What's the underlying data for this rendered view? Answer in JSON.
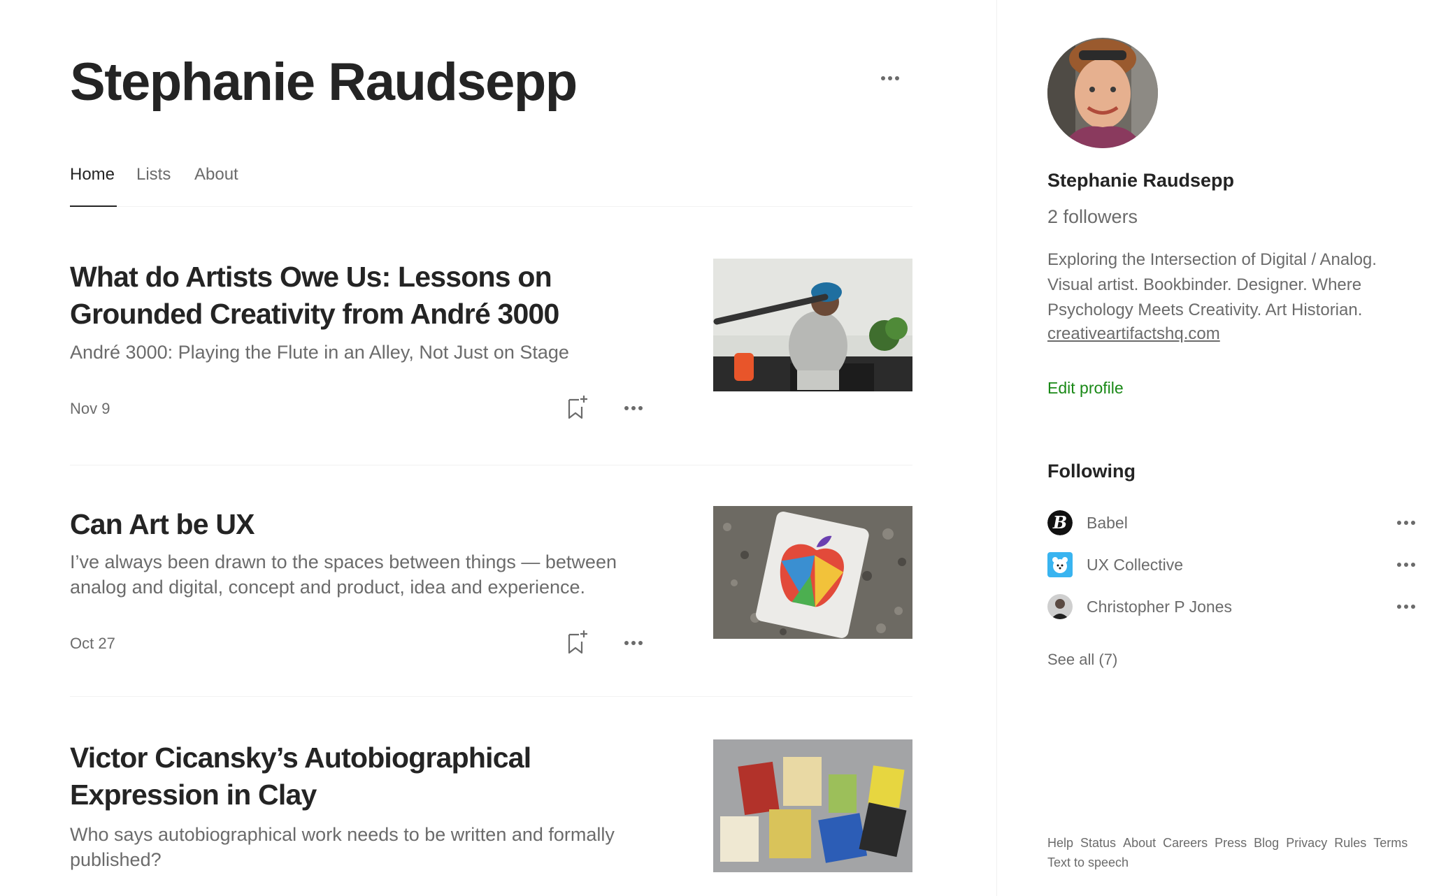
{
  "profile": {
    "name": "Stephanie Raudsepp"
  },
  "tabs": [
    {
      "label": "Home",
      "active": true
    },
    {
      "label": "Lists",
      "active": false
    },
    {
      "label": "About",
      "active": false
    }
  ],
  "articles": [
    {
      "title": "What do Artists Owe Us: Lessons on Grounded Creativity from André 3000",
      "subtitle": "André 3000: Playing the Flute in an Alley, Not Just on Stage",
      "date": "Nov 9",
      "thumbnail_icon": "musician-flute-photo"
    },
    {
      "title": "Can Art be UX",
      "subtitle": "I’ve always been drawn to the spaces between things — between analog and digital, concept and product, idea and experience.",
      "date": "Oct 27",
      "thumbnail_icon": "apple-logo-card-photo"
    },
    {
      "title": "Victor Cicansky’s Autobiographical Expression in Clay",
      "subtitle": "Who says autobiographical work needs to be written and formally published?",
      "thumbnail_icon": "clay-books-photo"
    }
  ],
  "sidebar": {
    "name": "Stephanie Raudsepp",
    "followers": "2 followers",
    "bio": "Exploring the Intersection of Digital / Analog. Visual artist. Bookbinder. Designer. Where Psychology Meets Creativity. Art Historian.",
    "link": "creativeartifactshq.com",
    "edit_profile": "Edit profile",
    "following_title": "Following",
    "following": [
      {
        "name": "Babel",
        "icon": "babel-logo-icon"
      },
      {
        "name": "UX Collective",
        "icon": "ux-collective-bear-icon"
      },
      {
        "name": "Christopher P Jones",
        "icon": "person-avatar-icon"
      }
    ],
    "see_all": "See all (7)",
    "footer_links": [
      "Help",
      "Status",
      "About",
      "Careers",
      "Press",
      "Blog",
      "Privacy",
      "Rules",
      "Terms",
      "Text to speech"
    ]
  },
  "colors": {
    "text_primary": "#242424",
    "text_secondary": "#6b6b6b",
    "accent_green": "#1a8917",
    "divider": "#f2f2f2"
  }
}
